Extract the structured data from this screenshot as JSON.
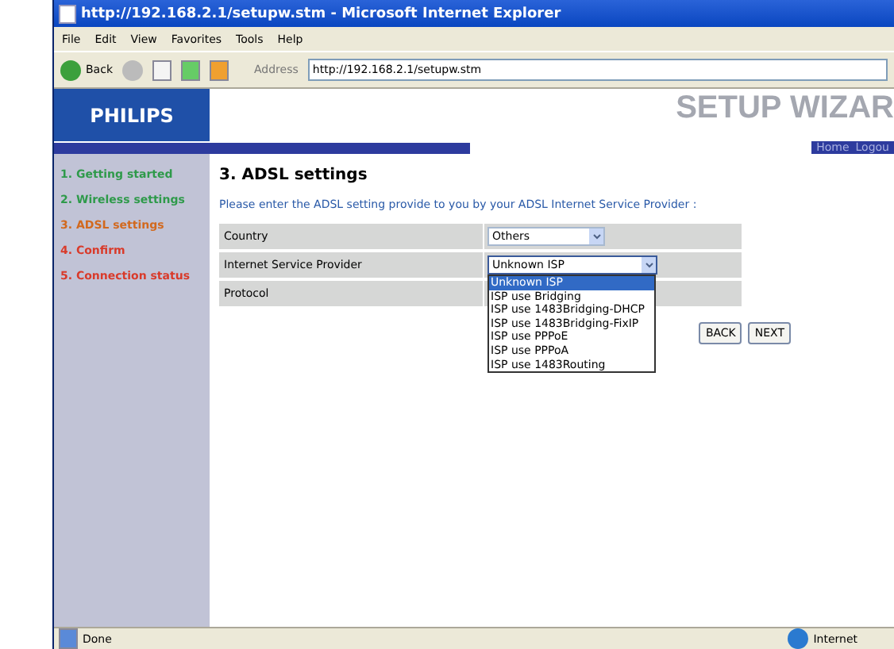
{
  "window": {
    "title": "http://192.168.2.1/setupw.stm - Microsoft Internet Explorer"
  },
  "menu_bar": [
    "File",
    "Edit",
    "View",
    "Favorites",
    "Tools",
    "Help"
  ],
  "toolbar": {
    "back_label": "Back",
    "address_label": "Address",
    "url": "http://192.168.2.1/setupw.stm"
  },
  "header": {
    "logo": "PHILIPS",
    "wizard_title": "SETUP WIZAR",
    "nav_links": [
      "Home",
      "Logou"
    ]
  },
  "sidebar": {
    "items": [
      {
        "label": "1. Getting started",
        "color": "#2e9a4a"
      },
      {
        "label": "2. Wireless settings",
        "color": "#2e9a4a"
      },
      {
        "label": "3. ADSL settings",
        "color": "#d2691e"
      },
      {
        "label": "4. Confirm",
        "color": "#d93a2a"
      },
      {
        "label": "5. Connection status",
        "color": "#d93a2a"
      }
    ]
  },
  "content": {
    "heading": "3. ADSL settings",
    "intro": "Please enter the ADSL setting provide to you by your ADSL Internet Service Provider :",
    "rows": [
      {
        "label": "Country",
        "kind": "select",
        "value": "Others",
        "expanded": false
      },
      {
        "label": "Internet Service Provider",
        "kind": "select",
        "value": "Unknown ISP",
        "expanded": true,
        "options": [
          {
            "label": "Unknown ISP",
            "selected": true
          },
          {
            "label": "ISP use Bridging",
            "selected": false
          },
          {
            "label": "ISP use 1483Bridging-DHCP",
            "selected": false
          },
          {
            "label": "ISP use 1483Bridging-FixIP",
            "selected": false
          },
          {
            "label": "ISP use PPPoE",
            "selected": false
          },
          {
            "label": "ISP use PPPoA",
            "selected": false
          },
          {
            "label": "ISP use 1483Routing",
            "selected": false
          }
        ]
      },
      {
        "label": "Protocol",
        "kind": "empty"
      }
    ],
    "buttons": [
      "BACK",
      "NEXT"
    ]
  },
  "status_bar": {
    "text": "Done",
    "zone": "Internet"
  }
}
